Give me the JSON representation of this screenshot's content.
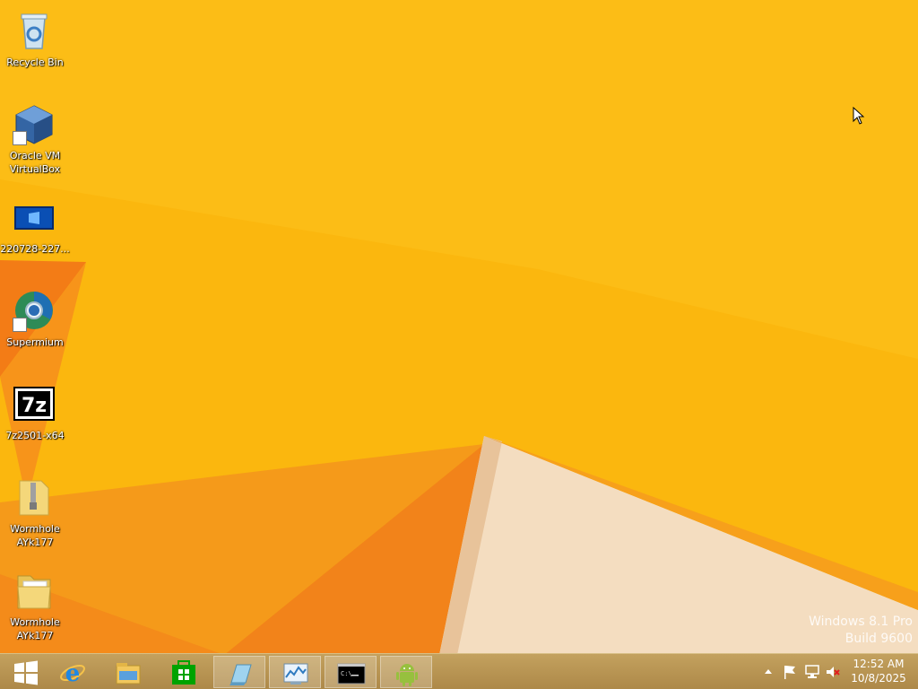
{
  "desktop": {
    "icons": [
      {
        "label": "Recycle Bin",
        "icon": "recycle-bin-icon"
      },
      {
        "label": "Oracle VM\nVirtualBox",
        "icon": "virtualbox-icon"
      },
      {
        "label": "220728-227...",
        "icon": "windows-image-icon"
      },
      {
        "label": "Supermium",
        "icon": "supermium-icon"
      },
      {
        "label": "7z2501-x64",
        "icon": "7zip-icon"
      },
      {
        "label": "Wormhole\nAYk177",
        "icon": "zip-folder-icon"
      },
      {
        "label": "Wormhole\nAYk177",
        "icon": "folder-icon"
      }
    ],
    "watermark": {
      "line1": "Windows 8.1 Pro",
      "line2": "Build 9600"
    }
  },
  "taskbar": {
    "buttons": [
      {
        "name": "start",
        "icon": "windows-logo-icon"
      },
      {
        "name": "internet-explorer",
        "icon": "internet-explorer-icon"
      },
      {
        "name": "file-explorer",
        "icon": "file-explorer-icon"
      },
      {
        "name": "store",
        "icon": "store-icon"
      },
      {
        "name": "app-notepad",
        "icon": "notepad-icon"
      },
      {
        "name": "app-control-panel",
        "icon": "control-panel-icon"
      },
      {
        "name": "app-command-prompt",
        "icon": "command-prompt-icon"
      },
      {
        "name": "app-android",
        "icon": "android-icon"
      }
    ],
    "tray": {
      "icons": [
        "chevron-up-icon",
        "flag-icon",
        "network-icon",
        "speaker-muted-icon"
      ]
    },
    "clock": {
      "time": "12:52 AM",
      "date": "10/8/2025"
    }
  },
  "colors": {
    "wallpaper": "#fbb70e",
    "taskbar": "#b8965a"
  }
}
